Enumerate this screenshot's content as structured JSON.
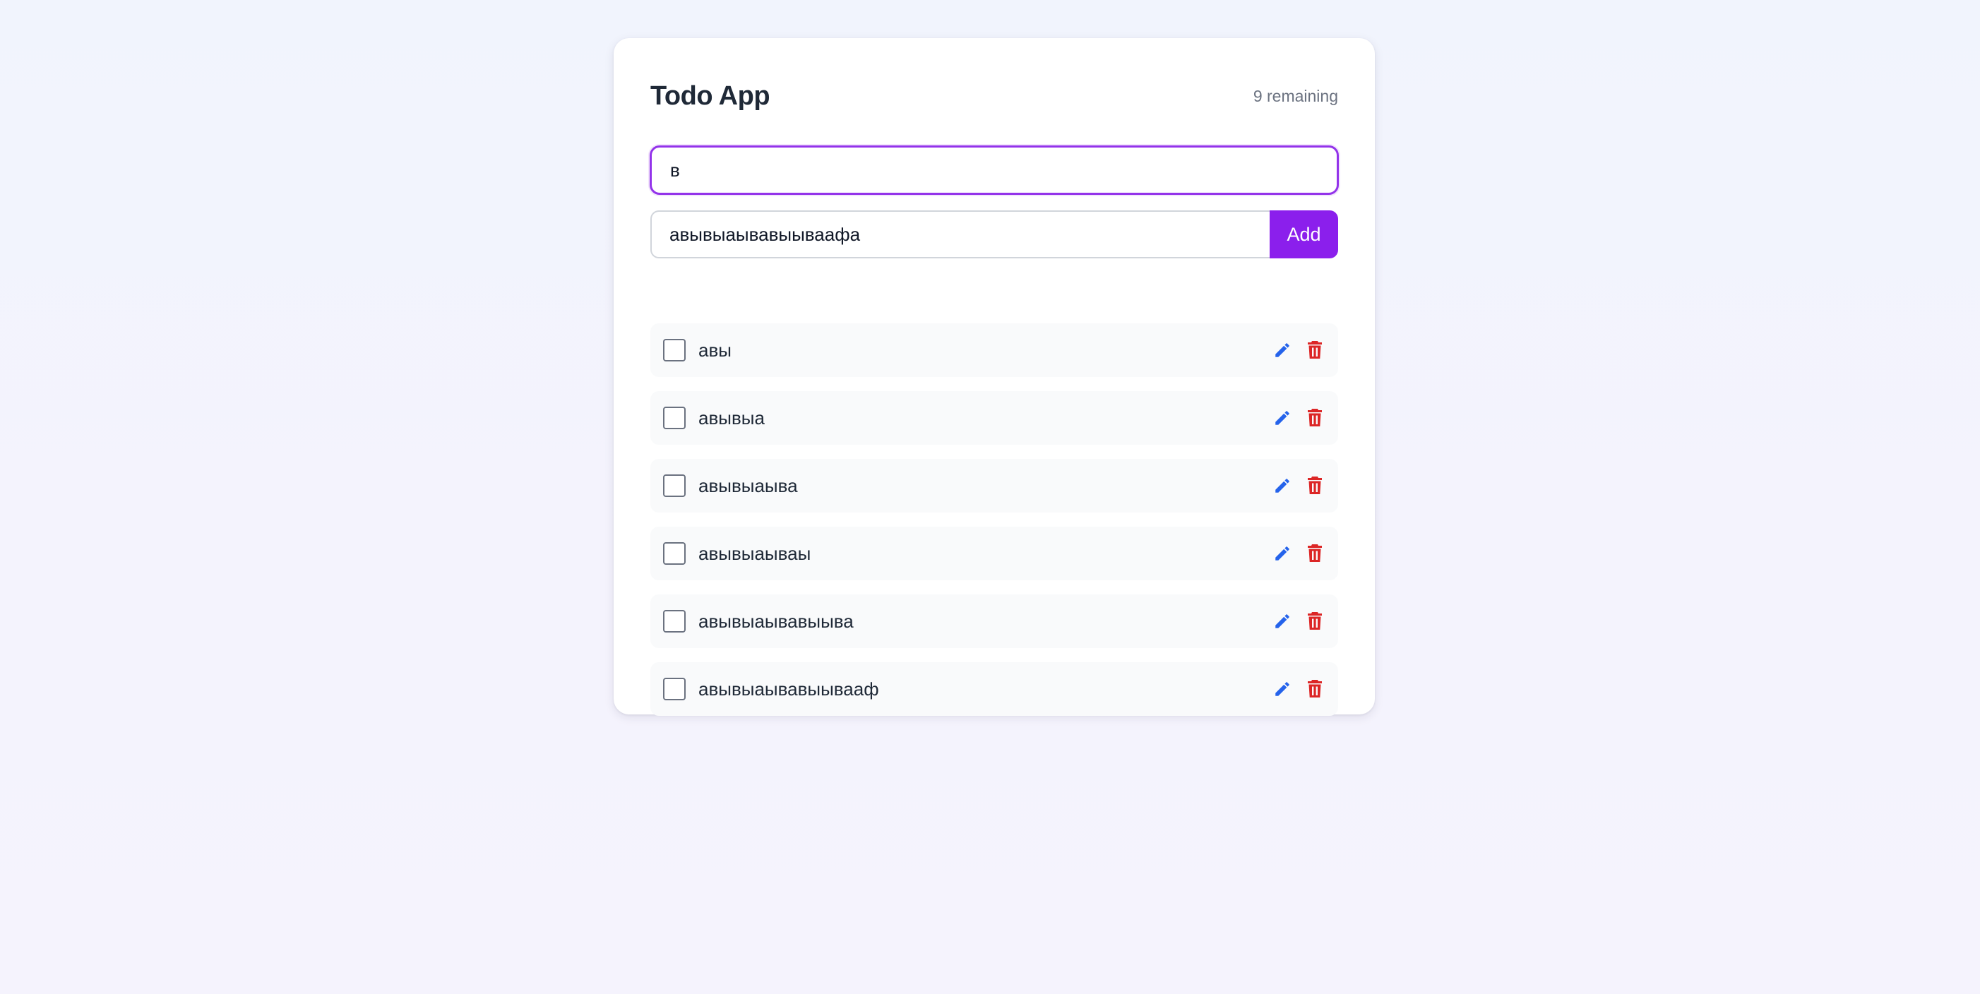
{
  "app": {
    "title": "Todo App",
    "remaining": "9 remaining"
  },
  "search": {
    "value": "в"
  },
  "new_todo": {
    "value": "авывыаывавыываафа",
    "add_label": "Add"
  },
  "todos": [
    {
      "text": "авы",
      "completed": false
    },
    {
      "text": "авывыа",
      "completed": false
    },
    {
      "text": "авывыаыва",
      "completed": false
    },
    {
      "text": "авывыаываы",
      "completed": false
    },
    {
      "text": "авывыаывавыыва",
      "completed": false
    },
    {
      "text": "авывыаывавыываaф",
      "completed": false
    }
  ],
  "icons": {
    "edit": "pencil-icon",
    "delete": "trash-icon"
  },
  "colors": {
    "accent": "#8b1fec",
    "focus_border": "#9333ea",
    "edit_icon": "#2563eb",
    "delete_icon": "#dc2626"
  }
}
